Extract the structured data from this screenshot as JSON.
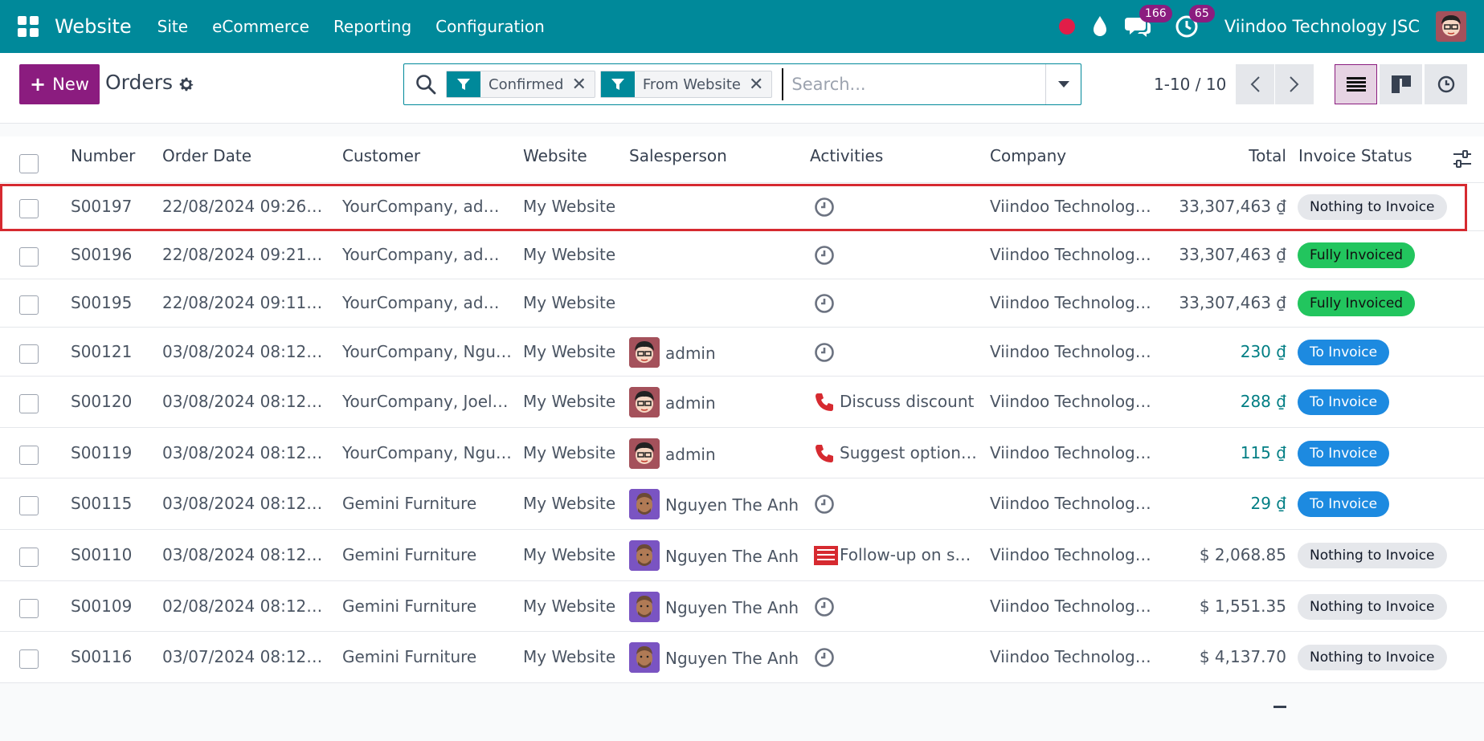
{
  "navbar": {
    "app_name": "Website",
    "menu": [
      "Site",
      "eCommerce",
      "Reporting",
      "Configuration"
    ],
    "messages_badge": "166",
    "activities_badge": "65",
    "company": "Viindoo Technology JSC",
    "bg_color": "#00899a"
  },
  "control": {
    "new_label": "New",
    "title": "Orders",
    "facets": [
      "Confirmed",
      "From Website"
    ],
    "search_placeholder": "Search...",
    "pager": "1-10 / 10",
    "accent_color": "#8b1c7f"
  },
  "table": {
    "columns": [
      "Number",
      "Order Date",
      "Customer",
      "Website",
      "Salesperson",
      "Activities",
      "Company",
      "Total",
      "Invoice Status"
    ],
    "rows": [
      {
        "number": "S00197",
        "date": "22/08/2024 09:26:…",
        "customer": "YourCompany, adm…",
        "website": "My Website",
        "salesperson": "",
        "avatar": "",
        "activity": "",
        "activity_icon": "clock-icon",
        "company": "Viindoo Technolog…",
        "total": "33,307,463 ₫",
        "total_link": false,
        "status": "Nothing to Invoice",
        "status_kind": "nothing"
      },
      {
        "number": "S00196",
        "date": "22/08/2024 09:21:…",
        "customer": "YourCompany, adm…",
        "website": "My Website",
        "salesperson": "",
        "avatar": "",
        "activity": "",
        "activity_icon": "clock-icon",
        "company": "Viindoo Technolog…",
        "total": "33,307,463 ₫",
        "total_link": false,
        "status": "Fully Invoiced",
        "status_kind": "full"
      },
      {
        "number": "S00195",
        "date": "22/08/2024 09:11:…",
        "customer": "YourCompany, adm…",
        "website": "My Website",
        "salesperson": "",
        "avatar": "",
        "activity": "",
        "activity_icon": "clock-icon",
        "company": "Viindoo Technolog…",
        "total": "33,307,463 ₫",
        "total_link": false,
        "status": "Fully Invoiced",
        "status_kind": "full"
      },
      {
        "number": "S00121",
        "date": "03/08/2024 08:12:…",
        "customer": "YourCompany, Ngu…",
        "website": "My Website",
        "salesperson": "admin",
        "avatar": "admin",
        "activity": "",
        "activity_icon": "clock-icon",
        "company": "Viindoo Technolog…",
        "total": "230 ₫",
        "total_link": true,
        "status": "To Invoice",
        "status_kind": "toinv"
      },
      {
        "number": "S00120",
        "date": "03/08/2024 08:12:…",
        "customer": "YourCompany, Joel…",
        "website": "My Website",
        "salesperson": "admin",
        "avatar": "admin",
        "activity": "Discuss discount",
        "activity_icon": "phone-icon",
        "company": "Viindoo Technolog…",
        "total": "288 ₫",
        "total_link": true,
        "status": "To Invoice",
        "status_kind": "toinv"
      },
      {
        "number": "S00119",
        "date": "03/08/2024 08:12:…",
        "customer": "YourCompany, Ngu…",
        "website": "My Website",
        "salesperson": "admin",
        "avatar": "admin",
        "activity": "Suggest option…",
        "activity_icon": "phone-icon",
        "company": "Viindoo Technolog…",
        "total": "115 ₫",
        "total_link": true,
        "status": "To Invoice",
        "status_kind": "toinv"
      },
      {
        "number": "S00115",
        "date": "03/08/2024 08:12:…",
        "customer": "Gemini Furniture",
        "website": "My Website",
        "salesperson": "Nguyen The Anh",
        "avatar": "nguyen",
        "activity": "",
        "activity_icon": "clock-icon",
        "company": "Viindoo Technolog…",
        "total": "29 ₫",
        "total_link": true,
        "status": "To Invoice",
        "status_kind": "toinv"
      },
      {
        "number": "S00110",
        "date": "03/08/2024 08:12:…",
        "customer": "Gemini Furniture",
        "website": "My Website",
        "salesperson": "Nguyen The Anh",
        "avatar": "nguyen",
        "activity": "Follow-up on sa…",
        "activity_icon": "todo-icon",
        "company": "Viindoo Technolog…",
        "total": "$ 2,068.85",
        "total_link": false,
        "status": "Nothing to Invoice",
        "status_kind": "nothing"
      },
      {
        "number": "S00109",
        "date": "02/08/2024 08:12:…",
        "customer": "Gemini Furniture",
        "website": "My Website",
        "salesperson": "Nguyen The Anh",
        "avatar": "nguyen",
        "activity": "",
        "activity_icon": "clock-icon",
        "company": "Viindoo Technolog…",
        "total": "$ 1,551.35",
        "total_link": false,
        "status": "Nothing to Invoice",
        "status_kind": "nothing"
      },
      {
        "number": "S00116",
        "date": "03/07/2024 08:12:…",
        "customer": "Gemini Furniture",
        "website": "My Website",
        "salesperson": "Nguyen The Anh",
        "avatar": "nguyen",
        "activity": "",
        "activity_icon": "clock-icon",
        "company": "Viindoo Technolog…",
        "total": "$ 4,137.70",
        "total_link": false,
        "status": "Nothing to Invoice",
        "status_kind": "nothing"
      }
    ]
  }
}
